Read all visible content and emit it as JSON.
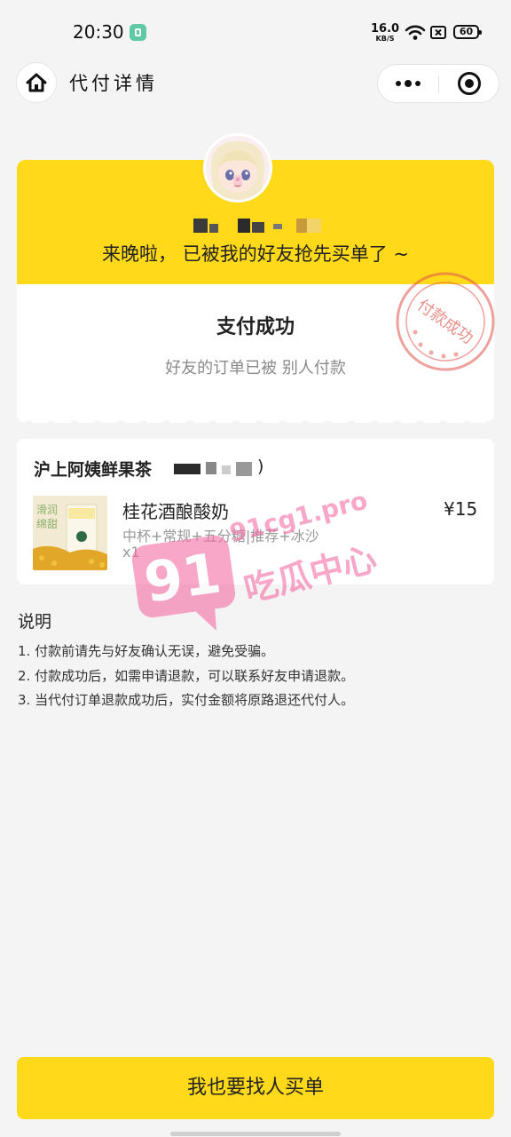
{
  "status_bar": {
    "time": "20:30",
    "net_speed": "16.0",
    "net_speed_unit": "KB/S",
    "battery": "60",
    "icons": [
      "app-notification-icon",
      "wifi-icon",
      "sim-icon",
      "battery-icon"
    ]
  },
  "nav": {
    "title": "代付详情",
    "home_icon": "home-icon",
    "more_icon": "more-dots-icon",
    "close_icon": "target-close-icon"
  },
  "result": {
    "message": "来晚啦， 已被我的好友抢先买单了 ~",
    "title": "支付成功",
    "description": "好友的订单已被 别人付款",
    "stamp_text": "付款成功",
    "accent_color": "#ffd91a",
    "stamp_color": "#e0524a"
  },
  "order": {
    "shop_name": "沪上阿姨鲜果茶",
    "shop_name_tail": ")",
    "product": {
      "name": "桂花酒酿酸奶",
      "options": "中杯+常规+五分糖|推荐+冰沙",
      "quantity": "x1",
      "price": "¥15",
      "image_text_1": "滑润",
      "image_text_2": "绵甜"
    }
  },
  "notes": {
    "title": "说明",
    "items": [
      "1. 付款前请先与好友确认无误，避免受骗。",
      "2. 付款成功后，如需申请退款，可以联系好友申请退款。",
      "3. 当代付订单退款成功后，实付金额将原路退还代付人。"
    ]
  },
  "watermark": {
    "logo": "91",
    "site": "91cg1.pro",
    "name": "吃瓜中心"
  },
  "bottom_button": {
    "label": "我也要找人买单"
  }
}
